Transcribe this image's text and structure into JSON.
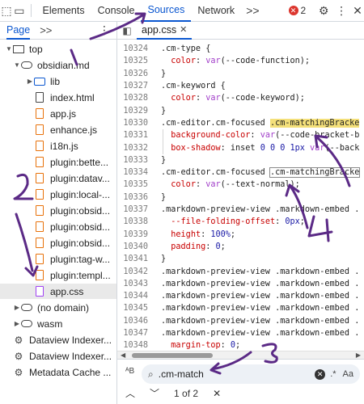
{
  "toolbar": {
    "tabs": [
      "Elements",
      "Console",
      "Sources",
      "Network"
    ],
    "active_tab": "Sources",
    "more_tabs": ">>",
    "error_count": "2"
  },
  "left_panel": {
    "tab_label": "Page",
    "more_label": ">>",
    "tree": [
      {
        "label": "top",
        "type": "frame"
      },
      {
        "label": "obsidian.md",
        "type": "cloud"
      },
      {
        "label": "lib",
        "type": "folder"
      },
      {
        "label": "index.html",
        "type": "plain"
      },
      {
        "label": "app.js",
        "type": "js"
      },
      {
        "label": "enhance.js",
        "type": "js"
      },
      {
        "label": "i18n.js",
        "type": "js"
      },
      {
        "label": "plugin:bette...",
        "type": "js"
      },
      {
        "label": "plugin:datav...",
        "type": "js"
      },
      {
        "label": "plugin:local-...",
        "type": "js"
      },
      {
        "label": "plugin:obsid...",
        "type": "js"
      },
      {
        "label": "plugin:obsid...",
        "type": "js"
      },
      {
        "label": "plugin:obsid...",
        "type": "js"
      },
      {
        "label": "plugin:tag-w...",
        "type": "js"
      },
      {
        "label": "plugin:templ...",
        "type": "js"
      },
      {
        "label": "app.css",
        "type": "css"
      },
      {
        "label": "(no domain)",
        "type": "cloud"
      },
      {
        "label": "wasm",
        "type": "cloud"
      },
      {
        "label": "Dataview Indexer...",
        "type": "gears"
      },
      {
        "label": "Dataview Indexer...",
        "type": "gears"
      },
      {
        "label": "Metadata Cache ...",
        "type": "gears"
      }
    ]
  },
  "editor": {
    "open_file": "app.css",
    "lines": [
      {
        "n": "10324",
        "segs": [
          [
            "sel",
            ".cm-type {"
          ]
        ]
      },
      {
        "n": "10325",
        "segs": [
          [
            "sp",
            "  "
          ],
          [
            "prop",
            "color"
          ],
          [
            "p",
            ": "
          ],
          [
            "kw",
            "var"
          ],
          [
            "p",
            "(--code-function);"
          ]
        ]
      },
      {
        "n": "10326",
        "segs": [
          [
            "p",
            "}"
          ]
        ]
      },
      {
        "n": "10327",
        "segs": [
          [
            "sel",
            ".cm-keyword {"
          ]
        ]
      },
      {
        "n": "10328",
        "segs": [
          [
            "sp",
            "  "
          ],
          [
            "prop",
            "color"
          ],
          [
            "p",
            ": "
          ],
          [
            "kw",
            "var"
          ],
          [
            "p",
            "(--code-keyword);"
          ]
        ]
      },
      {
        "n": "10329",
        "segs": [
          [
            "p",
            "}"
          ]
        ]
      },
      {
        "n": "10330",
        "segs": [
          [
            "sel",
            ".cm-editor.cm-focused "
          ],
          [
            "hl",
            ".cm-matchingBracke"
          ]
        ]
      },
      {
        "n": "10331",
        "segs": [
          [
            "sp",
            "  "
          ],
          [
            "prop",
            "background-color"
          ],
          [
            "p",
            ": "
          ],
          [
            "kw",
            "var"
          ],
          [
            "p",
            "(--code-bracket-b"
          ]
        ]
      },
      {
        "n": "10332",
        "segs": [
          [
            "sp",
            "  "
          ],
          [
            "prop",
            "box-shadow"
          ],
          [
            "p",
            ": inset "
          ],
          [
            "num",
            "0 0 0 1px "
          ],
          [
            "kw",
            "var"
          ],
          [
            "p",
            "(--back"
          ]
        ]
      },
      {
        "n": "10333",
        "segs": [
          [
            "p",
            "}"
          ]
        ]
      },
      {
        "n": "10334",
        "segs": [
          [
            "sel",
            ".cm-editor.cm-focused "
          ],
          [
            "outline",
            ".cm-matchingBracke"
          ]
        ]
      },
      {
        "n": "10335",
        "segs": [
          [
            "sp",
            "  "
          ],
          [
            "prop",
            "color"
          ],
          [
            "p",
            ": "
          ],
          [
            "kw",
            "var"
          ],
          [
            "p",
            "(--text-normal);"
          ]
        ]
      },
      {
        "n": "10336",
        "segs": [
          [
            "p",
            "}"
          ]
        ]
      },
      {
        "n": "10337",
        "segs": [
          [
            "sel",
            ".markdown-preview-view .markdown-embed ."
          ]
        ]
      },
      {
        "n": "10338",
        "segs": [
          [
            "sp",
            "  "
          ],
          [
            "prop",
            "--file-folding-offset"
          ],
          [
            "p",
            ": "
          ],
          [
            "num",
            "0px"
          ],
          [
            "p",
            ";"
          ]
        ]
      },
      {
        "n": "10339",
        "segs": [
          [
            "sp",
            "  "
          ],
          [
            "prop",
            "height"
          ],
          [
            "p",
            ": "
          ],
          [
            "num",
            "100%"
          ],
          [
            "p",
            ";"
          ]
        ]
      },
      {
        "n": "10340",
        "segs": [
          [
            "sp",
            "  "
          ],
          [
            "prop",
            "padding"
          ],
          [
            "p",
            ": "
          ],
          [
            "num",
            "0"
          ],
          [
            "p",
            ";"
          ]
        ]
      },
      {
        "n": "10341",
        "segs": [
          [
            "p",
            "}"
          ]
        ]
      },
      {
        "n": "10342",
        "segs": [
          [
            "sel",
            ".markdown-preview-view .markdown-embed ."
          ]
        ]
      },
      {
        "n": "10343",
        "segs": [
          [
            "sel",
            ".markdown-preview-view .markdown-embed ."
          ]
        ]
      },
      {
        "n": "10344",
        "segs": [
          [
            "sel",
            ".markdown-preview-view .markdown-embed ."
          ]
        ]
      },
      {
        "n": "10345",
        "segs": [
          [
            "sel",
            ".markdown-preview-view .markdown-embed ."
          ]
        ]
      },
      {
        "n": "10346",
        "segs": [
          [
            "sel",
            ".markdown-preview-view .markdown-embed ."
          ]
        ]
      },
      {
        "n": "10347",
        "segs": [
          [
            "sel",
            ".markdown-preview-view .markdown-embed ."
          ]
        ]
      },
      {
        "n": "10348",
        "segs": [
          [
            "sp",
            "  "
          ],
          [
            "prop",
            "margin-top"
          ],
          [
            "p",
            ": "
          ],
          [
            "num",
            "0"
          ],
          [
            "p",
            ";"
          ]
        ]
      }
    ]
  },
  "search": {
    "value": ".cm-match",
    "result_label": "1 of 2",
    "regex_label": ".*",
    "case_label": "Aa"
  },
  "annotations": [
    "1",
    "2",
    "3",
    "4"
  ]
}
